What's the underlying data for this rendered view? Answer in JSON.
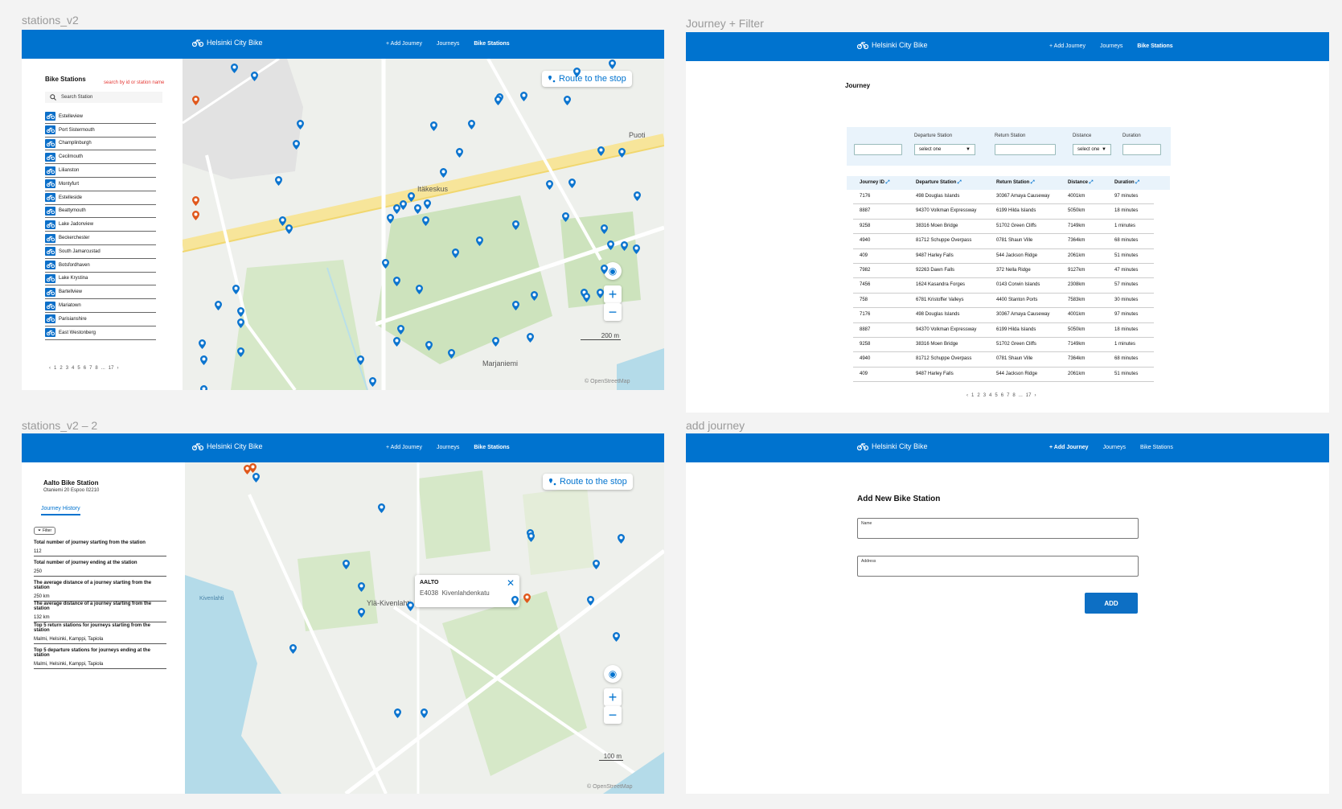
{
  "frames": {
    "stations": {
      "title": "stations_v2"
    },
    "journey": {
      "title": "Journey + Filter"
    },
    "detail": {
      "title": "stations_v2 – 2"
    },
    "add": {
      "title": "add journey"
    }
  },
  "header": {
    "brand": "Helsinki City Bike",
    "nav": {
      "add_journey": "+ Add Journey",
      "journeys": "Journeys",
      "bike_stations": "Bike Stations"
    }
  },
  "colors": {
    "primary": "#0073cf",
    "hint": "#e53935",
    "panel": "#e9f3fb"
  },
  "station_list": {
    "title": "Bike Stations",
    "hint": "search by id or station name",
    "search_placeholder": "Search Station",
    "items": [
      "Estelleview",
      "Port Sistermouth",
      "Champlinburgh",
      "Cecilmouth",
      "Lilianston",
      "Montyfurt",
      "Estelleside",
      "Beattymouth",
      "Lake Jadonview",
      "Beckerchester",
      "South Jamarcustad",
      "Botsfordhaven",
      "Lake Krystina",
      "Bartellview",
      "Mariatown",
      "Parisianshire",
      "East Westonberg"
    ],
    "pages": [
      "‹",
      "1",
      "2",
      "3",
      "4",
      "5",
      "6",
      "7",
      "8",
      "...",
      "17",
      "›"
    ]
  },
  "map": {
    "route_button": "Route to the stop",
    "scale_200": "200 m",
    "scale_100": "100 m",
    "attribution": "© OpenStreetMap",
    "labels_1": [
      "Itäkeskus",
      "Marjaniemi",
      "Puoti"
    ],
    "labels_2": [
      "Ylä-Kivenlahti",
      "Kivenlahti"
    ],
    "icons": {
      "route": "route-pin-icon",
      "locate": "locate-icon",
      "zoom_in": "plus-icon",
      "zoom_out": "minus-icon",
      "station_marker": "map-pin-icon"
    }
  },
  "journey": {
    "title": "Journey",
    "filters": {
      "departure_label": "Departure Station",
      "return_label": "Return Station",
      "distance_label": "Distance",
      "duration_label": "Duration",
      "select_one": "select one"
    },
    "columns": [
      "Journey ID",
      "Departure Station",
      "Return Station",
      "Distance",
      "Duration"
    ],
    "rows": [
      [
        "7176",
        "498 Douglas Islands",
        "30367 Amaya Causeway",
        "4001km",
        "97  minutes"
      ],
      [
        "8887",
        "94370 Volkman Expressway",
        "6199 Hilda Islands",
        "5050km",
        "18  minutes"
      ],
      [
        "9258",
        "38316 Moen Bridge",
        "51702 Green Cliffs",
        "7149km",
        "1  minutes"
      ],
      [
        "4940",
        "81712 Schuppe Overpass",
        "0781 Shaun Ville",
        "7364km",
        "68  minutes"
      ],
      [
        "409",
        "9487 Harley Falls",
        "544 Jackson Ridge",
        "2061km",
        "51  minutes"
      ],
      [
        "7982",
        "92263 Dawn Falls",
        "372 Nella Ridge",
        "9127km",
        "47  minutes"
      ],
      [
        "7456",
        "1624 Kasandra Forges",
        "0143 Corwin Islands",
        "2308km",
        "57  minutes"
      ],
      [
        "758",
        "6781 Kristoffer Valleys",
        "4400 Stanton Ports",
        "7583km",
        "30  minutes"
      ],
      [
        "7176",
        "498 Douglas Islands",
        "30367 Amaya Causeway",
        "4001km",
        "97  minutes"
      ],
      [
        "8887",
        "94370 Volkman Expressway",
        "6199 Hilda Islands",
        "5050km",
        "18  minutes"
      ],
      [
        "9258",
        "38316 Moen Bridge",
        "51702 Green Cliffs",
        "7149km",
        "1  minutes"
      ],
      [
        "4940",
        "81712 Schuppe Overpass",
        "0781 Shaun Ville",
        "7364km",
        "68  minutes"
      ],
      [
        "409",
        "9487 Harley Falls",
        "544 Jackson Ridge",
        "2061km",
        "51  minutes"
      ]
    ],
    "pages": [
      "‹",
      "1",
      "2",
      "3",
      "4",
      "5",
      "6",
      "7",
      "8",
      "...",
      "17",
      "›"
    ]
  },
  "detail": {
    "station_name": "Aalto Bike Station",
    "address": "Otaniemi 20 Espoo 02210",
    "tab": "Journey History",
    "filter": "Filter",
    "stats": [
      {
        "label": "Total number of journey starting from the station",
        "value": "112"
      },
      {
        "label": "Total number of journey ending at the station",
        "value": "250"
      },
      {
        "label": "The average distance of a journey starting from the station",
        "value": "250 km"
      },
      {
        "label": "The average distance of a journey starting from the station",
        "value": "132 km"
      },
      {
        "label": "Top 5 return stations for journeys starting from the station",
        "value": "Malmi, Helsinki, Kamppi, Tapiola"
      },
      {
        "label": "Top 5 departure stations for journeys ending at the station",
        "value": "Malmi, Helsinki, Kamppi, Tapiola"
      }
    ],
    "popup": {
      "name": "AALTO",
      "code": "E4038",
      "street": "Kivenlahdenkatu"
    }
  },
  "add_station": {
    "title": "Add New Bike Station",
    "name_label": "Name",
    "address_label": "Address",
    "button": "ADD"
  }
}
